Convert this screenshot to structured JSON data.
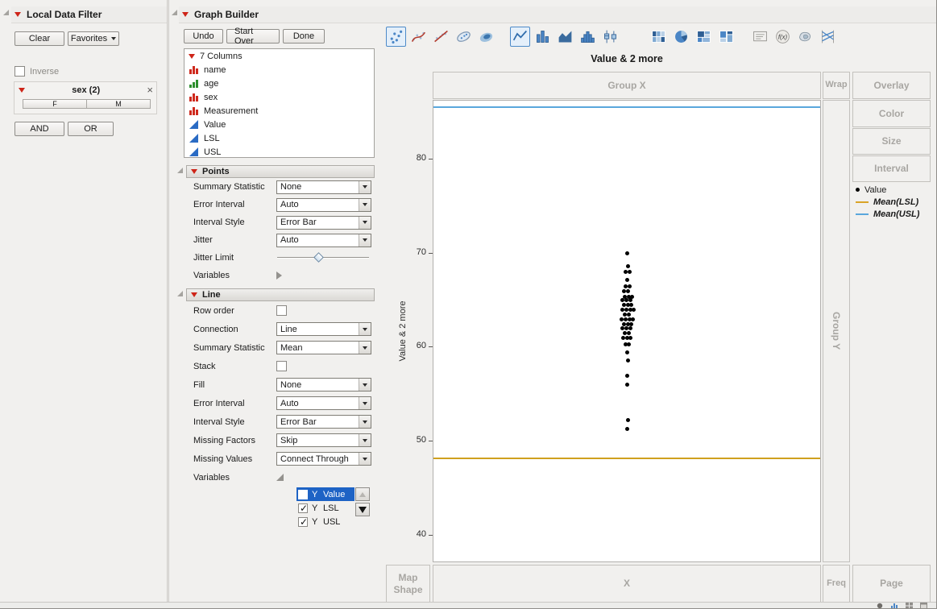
{
  "filter_panel": {
    "title": "Local Data Filter",
    "clear_label": "Clear",
    "favorites_label": "Favorites",
    "inverse_label": "Inverse",
    "and_label": "AND",
    "or_label": "OR",
    "filters": [
      {
        "title": "sex (2)",
        "levels": [
          "F",
          "M"
        ]
      }
    ]
  },
  "graph_builder": {
    "title": "Graph Builder",
    "undo_label": "Undo",
    "start_over_label": "Start Over",
    "done_label": "Done",
    "columns_panel": {
      "header": "7 Columns",
      "columns": [
        {
          "name": "name",
          "type": "nominal"
        },
        {
          "name": "age",
          "type": "ordinal"
        },
        {
          "name": "sex",
          "type": "nominal"
        },
        {
          "name": "Measurement",
          "type": "nominal"
        },
        {
          "name": "Value",
          "type": "continuous"
        },
        {
          "name": "LSL",
          "type": "continuous"
        },
        {
          "name": "USL",
          "type": "continuous"
        }
      ]
    },
    "toolbar": [
      {
        "name": "points",
        "selected": true
      },
      {
        "name": "smoother",
        "selected": false
      },
      {
        "name": "line-of-fit",
        "selected": false
      },
      {
        "name": "ellipse",
        "selected": false
      },
      {
        "name": "contour",
        "selected": false
      },
      {
        "name": "line",
        "selected": true
      },
      {
        "name": "bar",
        "selected": false
      },
      {
        "name": "area",
        "selected": false
      },
      {
        "name": "histogram",
        "selected": false
      },
      {
        "name": "box-plot",
        "selected": false
      },
      {
        "name": "heatmap",
        "selected": false
      },
      {
        "name": "pie",
        "selected": false
      },
      {
        "name": "treemap",
        "selected": false
      },
      {
        "name": "mosaic",
        "selected": false
      },
      {
        "name": "caption-box",
        "selected": false
      },
      {
        "name": "formula",
        "selected": false
      },
      {
        "name": "map-shapes",
        "selected": false
      },
      {
        "name": "parallel-plot",
        "selected": false
      }
    ],
    "points_section": {
      "title": "Points",
      "rows": [
        {
          "label": "Summary Statistic",
          "control": "select",
          "value": "None"
        },
        {
          "label": "Error Interval",
          "control": "select",
          "value": "Auto"
        },
        {
          "label": "Interval Style",
          "control": "select",
          "value": "Error Bar"
        },
        {
          "label": "Jitter",
          "control": "select",
          "value": "Auto"
        },
        {
          "label": "Jitter Limit",
          "control": "slider"
        },
        {
          "label": "Variables",
          "control": "disclosure-closed"
        }
      ]
    },
    "line_section": {
      "title": "Line",
      "rows": [
        {
          "label": "Row order",
          "control": "checkbox",
          "checked": false
        },
        {
          "label": "Connection",
          "control": "select",
          "value": "Line"
        },
        {
          "label": "Summary Statistic",
          "control": "select",
          "value": "Mean"
        },
        {
          "label": "Stack",
          "control": "checkbox",
          "checked": false
        },
        {
          "label": "Fill",
          "control": "select",
          "value": "None"
        },
        {
          "label": "Error Interval",
          "control": "select",
          "value": "Auto"
        },
        {
          "label": "Interval Style",
          "control": "select",
          "value": "Error Bar"
        },
        {
          "label": "Missing Factors",
          "control": "select",
          "value": "Skip"
        },
        {
          "label": "Missing Values",
          "control": "select",
          "value": "Connect Through"
        },
        {
          "label": "Variables",
          "control": "disclosure-open"
        }
      ],
      "variables": [
        {
          "role": "Y",
          "name": "Value",
          "checked": false,
          "selected": true
        },
        {
          "role": "Y",
          "name": "LSL",
          "checked": true,
          "selected": false
        },
        {
          "role": "Y",
          "name": "USL",
          "checked": true,
          "selected": false
        }
      ]
    },
    "zones": {
      "group_x": "Group X",
      "wrap": "Wrap",
      "overlay": "Overlay",
      "color": "Color",
      "size": "Size",
      "interval": "Interval",
      "group_y": "Group Y",
      "map_shape": "Map Shape",
      "x": "X",
      "freq": "Freq",
      "page": "Page"
    },
    "legend": [
      {
        "label": "Value",
        "marker": "dot",
        "color": "#000000",
        "italic": false
      },
      {
        "label": "Mean(LSL)",
        "marker": "line",
        "color": "#d9a427",
        "italic": true
      },
      {
        "label": "Mean(USL)",
        "marker": "line",
        "color": "#5aa7dc",
        "italic": true
      }
    ]
  },
  "chart_data": {
    "type": "scatter",
    "title": "Value & 2 more",
    "ylabel": "Value & 2 more",
    "xlabel": "X",
    "yticks": [
      40,
      50,
      60,
      70,
      80
    ],
    "ylim": [
      37,
      86.3
    ],
    "grid": false,
    "legend_position": "right",
    "points": [
      [
        70,
        0
      ],
      [
        68.6,
        1
      ],
      [
        68,
        -2
      ],
      [
        68,
        3
      ],
      [
        67.2,
        0
      ],
      [
        66.5,
        -2
      ],
      [
        66.5,
        3
      ],
      [
        66,
        -4
      ],
      [
        66,
        1
      ],
      [
        65.4,
        -3
      ],
      [
        65.4,
        2
      ],
      [
        65.4,
        6
      ],
      [
        65,
        -6
      ],
      [
        65,
        -1
      ],
      [
        65,
        4
      ],
      [
        64.5,
        -4
      ],
      [
        64.5,
        1
      ],
      [
        64.5,
        5
      ],
      [
        64,
        -6
      ],
      [
        64,
        -1
      ],
      [
        64,
        4
      ],
      [
        64,
        8
      ],
      [
        63.5,
        -3
      ],
      [
        63.5,
        2
      ],
      [
        63,
        -7
      ],
      [
        63,
        -2
      ],
      [
        63,
        3
      ],
      [
        63,
        7
      ],
      [
        62.5,
        -4
      ],
      [
        62.5,
        1
      ],
      [
        62.5,
        5
      ],
      [
        62,
        -6
      ],
      [
        62,
        -1
      ],
      [
        62,
        4
      ],
      [
        61.5,
        -3
      ],
      [
        61.5,
        2
      ],
      [
        61,
        -5
      ],
      [
        61,
        0
      ],
      [
        61,
        4
      ],
      [
        60.3,
        -2
      ],
      [
        60.3,
        2
      ],
      [
        59.5,
        0
      ],
      [
        58.6,
        1
      ],
      [
        57,
        0
      ],
      [
        56,
        0
      ],
      [
        52.3,
        1
      ],
      [
        51.3,
        0
      ]
    ],
    "ref_lines": [
      {
        "label": "Mean(USL)",
        "value": 85.6,
        "color": "#5aa7dc"
      },
      {
        "label": "Mean(LSL)",
        "value": 48.2,
        "color": "#cfa01e"
      }
    ]
  },
  "status_bar": {
    "icons": [
      "circle",
      "bar-chart",
      "grid",
      "window"
    ]
  },
  "accent_colors": {
    "selection_blue": "#1e63c5",
    "usl_blue": "#5aa7dc",
    "lsl_orange": "#cfa01e"
  }
}
